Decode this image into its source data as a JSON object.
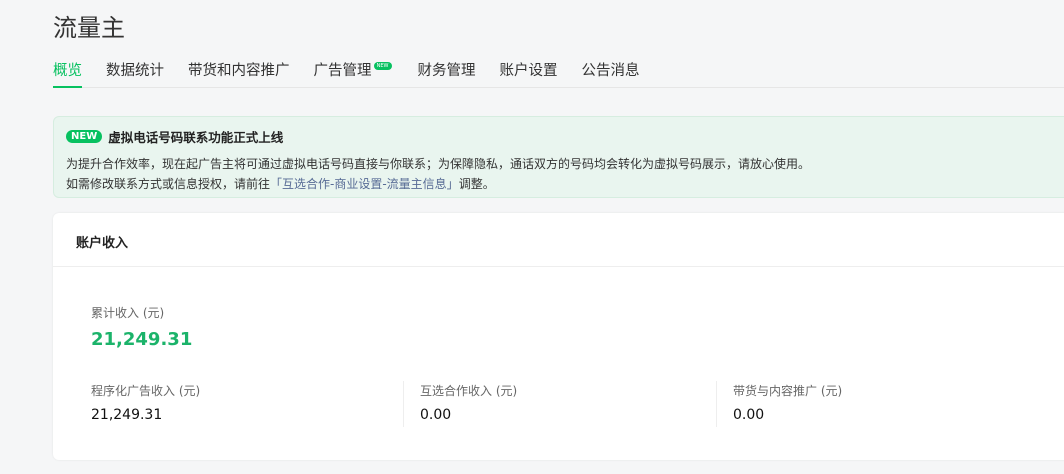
{
  "app_title": "流量主",
  "tabs": [
    {
      "label": "概览"
    },
    {
      "label": "数据统计"
    },
    {
      "label": "带货和内容推广"
    },
    {
      "label": "广告管理",
      "badge": "NEW"
    },
    {
      "label": "财务管理"
    },
    {
      "label": "账户设置"
    },
    {
      "label": "公告消息"
    }
  ],
  "notice": {
    "tag": "NEW",
    "title": "虚拟电话号码联系功能正式上线",
    "line1": "为提升合作效率，现在起广告主将可通过虚拟电话号码直接与你联系；为保障隐私，通话双方的号码均会转化为虚拟号码展示，请放心使用。",
    "line2_prefix": "如需修改联系方式或信息授权，请前往",
    "line2_link": "「互选合作-商业设置-流量主信息」",
    "line2_suffix": "调整。"
  },
  "income": {
    "title": "账户收入",
    "total_label": "累计收入 (元)",
    "total_value": "21,249.31",
    "items": [
      {
        "label": "程序化广告收入 (元)",
        "value": "21,249.31"
      },
      {
        "label": "互选合作收入 (元)",
        "value": "0.00"
      },
      {
        "label": "带货与内容推广 (元)",
        "value": "0.00"
      }
    ]
  },
  "colors": {
    "accent": "#07c160",
    "link": "#576b95"
  }
}
